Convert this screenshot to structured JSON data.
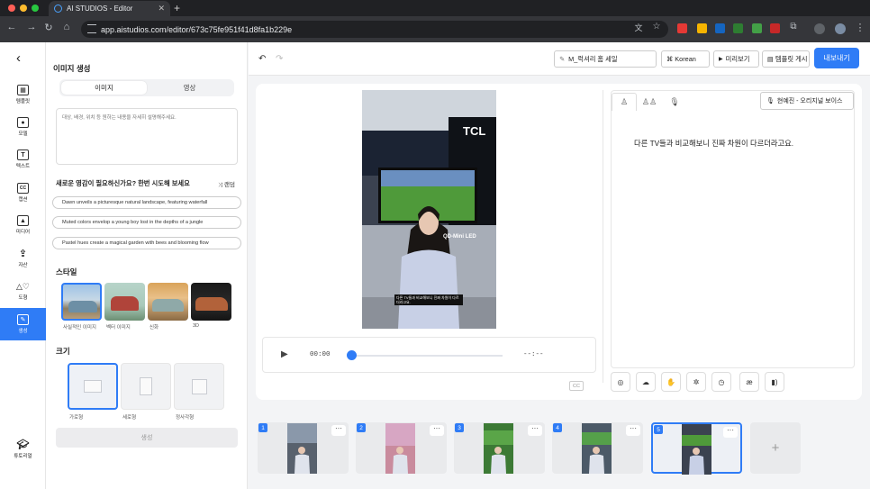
{
  "browser": {
    "tab_title": "AI STUDIOS - Editor",
    "url": "app.aistudios.com/editor/673c75fe951f41d8fa1b229e",
    "new_tab": "+",
    "close": "✕"
  },
  "sidebar": {
    "items": [
      {
        "label": "템플릿",
        "icon": "template-icon"
      },
      {
        "label": "모델",
        "icon": "model-icon"
      },
      {
        "label": "텍스트",
        "icon": "text-icon"
      },
      {
        "label": "캡션",
        "icon": "caption-icon"
      },
      {
        "label": "미디어",
        "icon": "media-icon"
      },
      {
        "label": "자산",
        "icon": "upload-icon"
      },
      {
        "label": "도형",
        "icon": "shapes-icon"
      },
      {
        "label": "생성",
        "icon": "generate-icon"
      },
      {
        "label": "튜토리얼",
        "icon": "tutorial-icon"
      }
    ],
    "active": "생성"
  },
  "panel": {
    "title": "이미지 생성",
    "tabs": [
      "이미지",
      "영상"
    ],
    "prompt_placeholder": "대상, 배경, 위치 등 원하는 내용을 자세히 설명해주세요.",
    "inspiration": "새로운 영감이 필요하신가요? 한번 시도해 보세요",
    "shuffle_label": "⤨ 랜덤",
    "suggestions": [
      "Dawn unveils a picturesque natural landscape, featuring waterfall",
      "Muted colors envelop a young boy lost in the depths of a jungle",
      "Pastel hues create a magical garden with bees and blooming flow"
    ],
    "style_heading": "스타일",
    "styles": [
      "사실적인 이미지",
      "벡터 이미지",
      "신화",
      "3D"
    ],
    "size_heading": "크기",
    "sizes": [
      "가로형",
      "세로형",
      "정사각형"
    ],
    "generate_label": "생성"
  },
  "topbar": {
    "undo": "↶",
    "redo": "↷",
    "project_name": "M_럭셔리 홈 세일",
    "language": "Korean",
    "preview": "미리보기",
    "template_post": "템플릿 게시",
    "export": "내보내기"
  },
  "video": {
    "brand": "TCL",
    "product": "QD-Mini LED",
    "subtitle": "다른 TV들과 비교해보니 진짜 차원이 다르더라고요."
  },
  "player": {
    "play": "▶",
    "time": "00:00",
    "duration": "--:--",
    "cc": "CC",
    "progress": 0
  },
  "script": {
    "voice": "현예진 - 오리지널 보이스",
    "text": "다른 TV들과 비교해보니 진짜 차원이 다르더라고요.",
    "tools": [
      "◎",
      "☁",
      "✋",
      "✲",
      "◷",
      "æ",
      "▮)"
    ]
  },
  "timeline": {
    "scenes": [
      "1",
      "2",
      "3",
      "4",
      "5"
    ],
    "selected": "5",
    "more": "···",
    "add": "+"
  },
  "colors": {
    "accent": "#2f7cf6"
  }
}
